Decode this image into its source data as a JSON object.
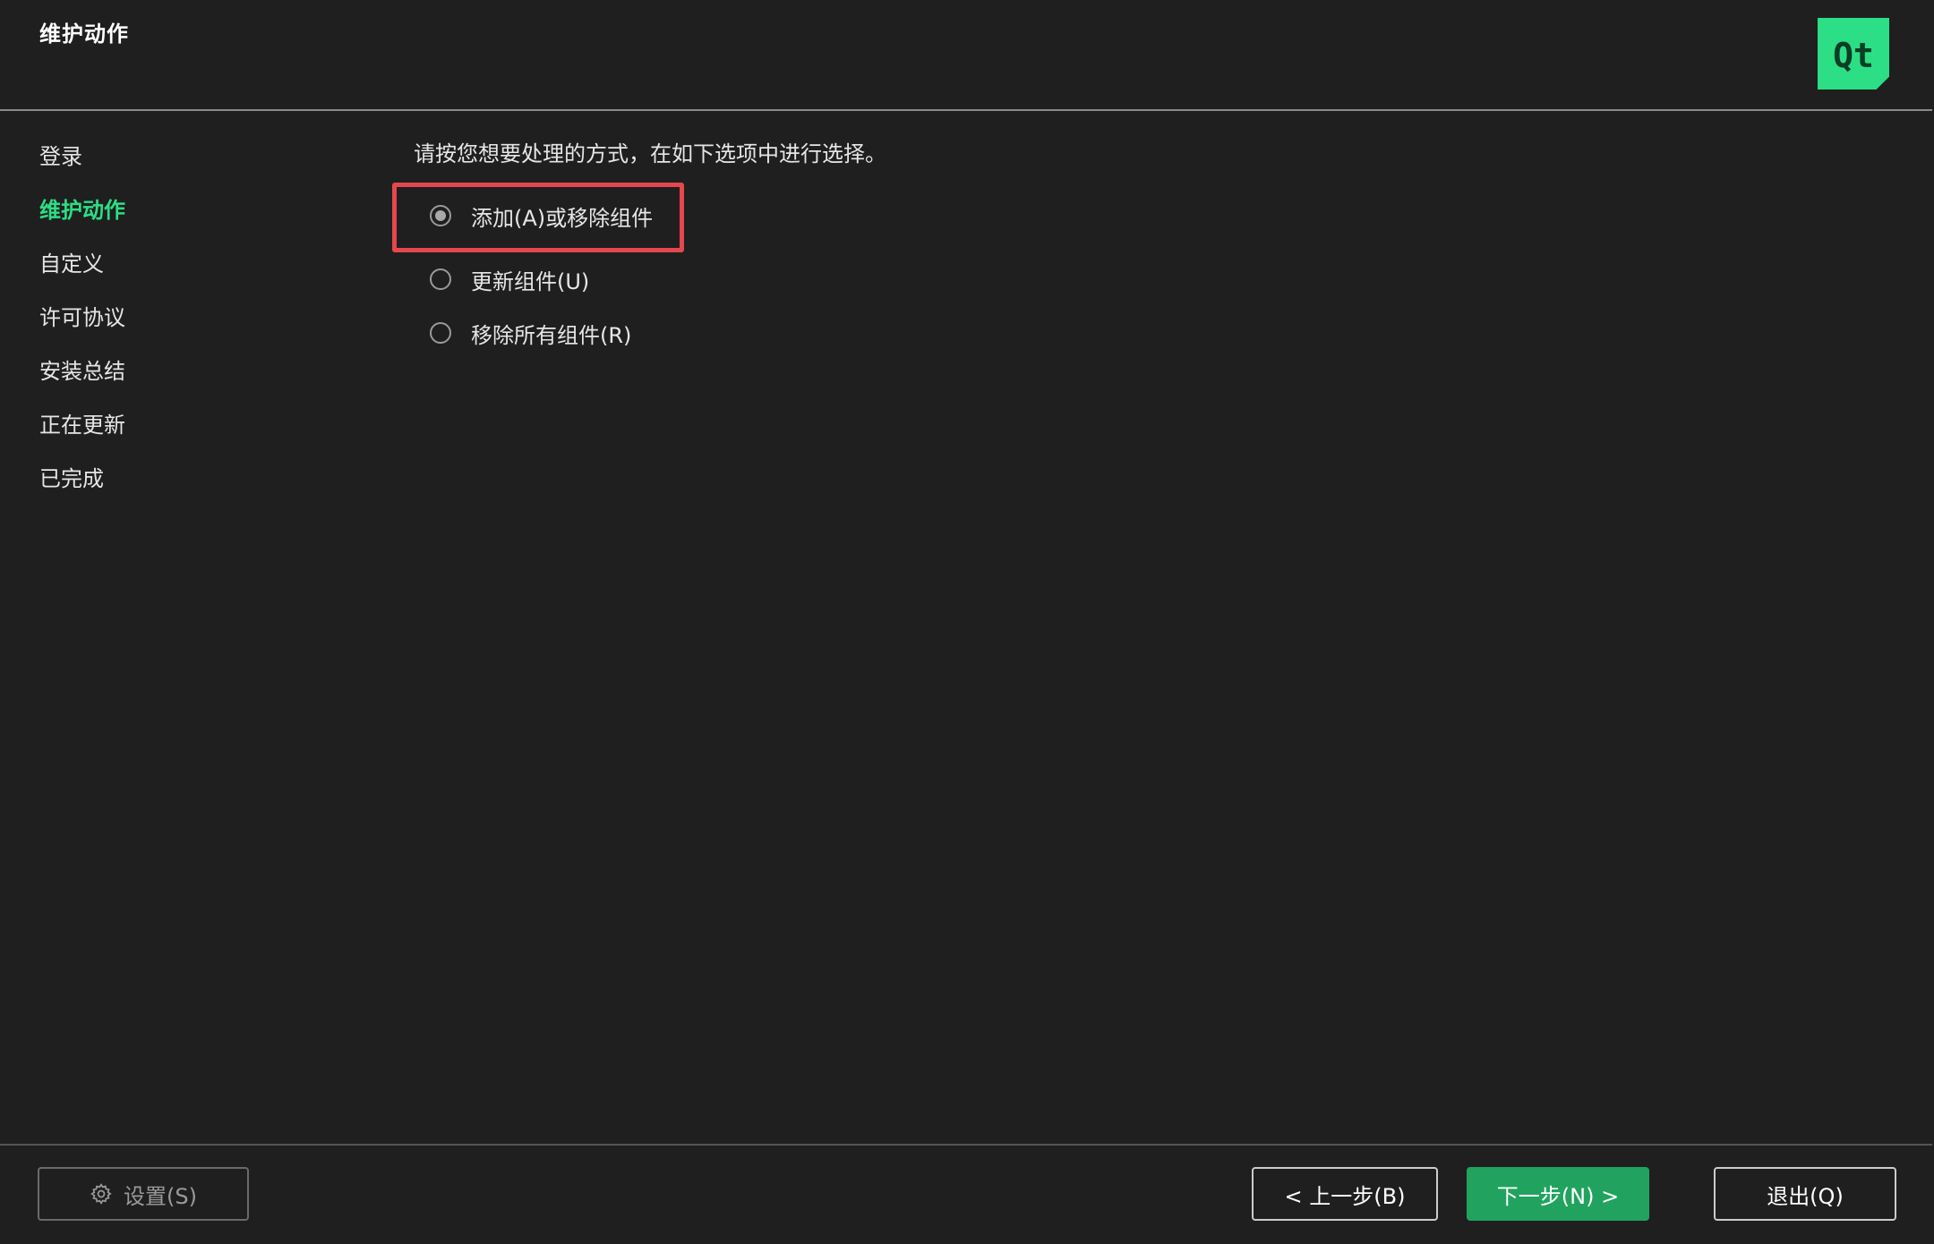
{
  "header": {
    "title": "维护动作",
    "logo_text": "Qt"
  },
  "sidebar": {
    "items": [
      {
        "label": "登录"
      },
      {
        "label": "维护动作"
      },
      {
        "label": "自定义"
      },
      {
        "label": "许可协议"
      },
      {
        "label": "安装总结"
      },
      {
        "label": "正在更新"
      },
      {
        "label": "已完成"
      }
    ],
    "active_index": 1
  },
  "main": {
    "instruction": "请按您想要处理的方式，在如下选项中进行选择。",
    "options": [
      {
        "label": "添加(A)或移除组件",
        "selected": true
      },
      {
        "label": "更新组件(U)",
        "selected": false
      },
      {
        "label": "移除所有组件(R)",
        "selected": false
      }
    ]
  },
  "footer": {
    "settings_label": "设置(S)",
    "back_label": "< 上一步(B)",
    "next_label": "下一步(N) >",
    "exit_label": "退出(Q)"
  },
  "colors": {
    "background": "#1f1f1f",
    "accent_green": "#2cde85",
    "next_button": "#21a35f",
    "highlight_red": "#e5474e"
  },
  "icons": {
    "settings": "gear-icon",
    "logo": "qt-logo"
  }
}
